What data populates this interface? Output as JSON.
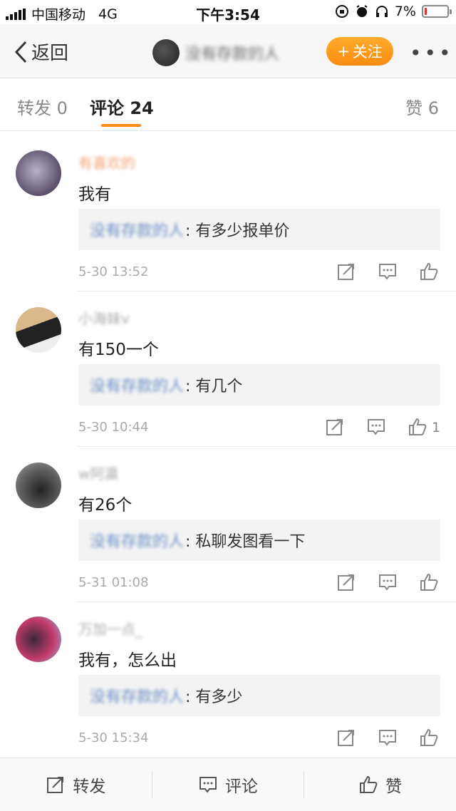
{
  "status_bar": {
    "carrier": "中国移动",
    "network": "4G",
    "time": "下午3:54",
    "battery": "7%",
    "battery_level": 0.07
  },
  "nav": {
    "back_label": "返回",
    "title": "没有存款的人",
    "follow_label": "关注",
    "more_label": "•••"
  },
  "tabs": [
    {
      "label": "转发 0"
    },
    {
      "label": "评论 24"
    },
    {
      "label": "赞 6"
    }
  ],
  "comments": [
    {
      "username": "有喜欢的",
      "text": "我有",
      "quote_user": "没有存款的人",
      "quote_text": ": 有多少报单价",
      "time": "5-30 13:52",
      "likes": ""
    },
    {
      "username": "小海妹v",
      "text": "有150一个",
      "quote_user": "没有存款的人",
      "quote_text": ": 有几个",
      "time": "5-30 10:44",
      "likes": "1"
    },
    {
      "username": "w阿瀛",
      "text": "有26个",
      "quote_user": "没有存款的人",
      "quote_text": ": 私聊发图看一下",
      "time": "5-31 01:08",
      "likes": ""
    },
    {
      "username": "万加一点_",
      "text": "我有，怎么出",
      "quote_user": "没有存款的人",
      "quote_text": ": 有多少",
      "time": "5-30 15:34",
      "likes": ""
    }
  ],
  "bottom_bar": {
    "repost_label": "转发",
    "comment_label": "评论",
    "like_label": "赞"
  },
  "colors": {
    "accent": "#f88c12",
    "follow_gradient_top": "#ffab2c",
    "quote_bg": "#f3f3f3",
    "meta_text": "#aaaaaa"
  }
}
